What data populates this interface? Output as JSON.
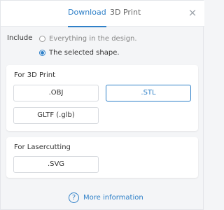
{
  "tabs": [
    {
      "label": "Download",
      "active": true
    },
    {
      "label": "3D Print",
      "active": false
    }
  ],
  "close_icon": "×",
  "include": {
    "label": "Include",
    "options": [
      {
        "label": "Everything in the design.",
        "checked": false
      },
      {
        "label": "The selected shape.",
        "checked": true
      }
    ]
  },
  "print3d": {
    "title": "For 3D Print",
    "buttons": [
      {
        "label": ".OBJ",
        "selected": false
      },
      {
        "label": ".STL",
        "selected": true
      },
      {
        "label": "GLTF (.glb)",
        "selected": false
      }
    ]
  },
  "laser": {
    "title": "For Lasercutting",
    "buttons": [
      {
        "label": ".SVG",
        "selected": false
      }
    ]
  },
  "more_info": {
    "icon_glyph": "?",
    "label": "More information"
  },
  "colors": {
    "accent": "#2f80c8",
    "background": "#f4f5f7",
    "card": "#ffffff"
  }
}
